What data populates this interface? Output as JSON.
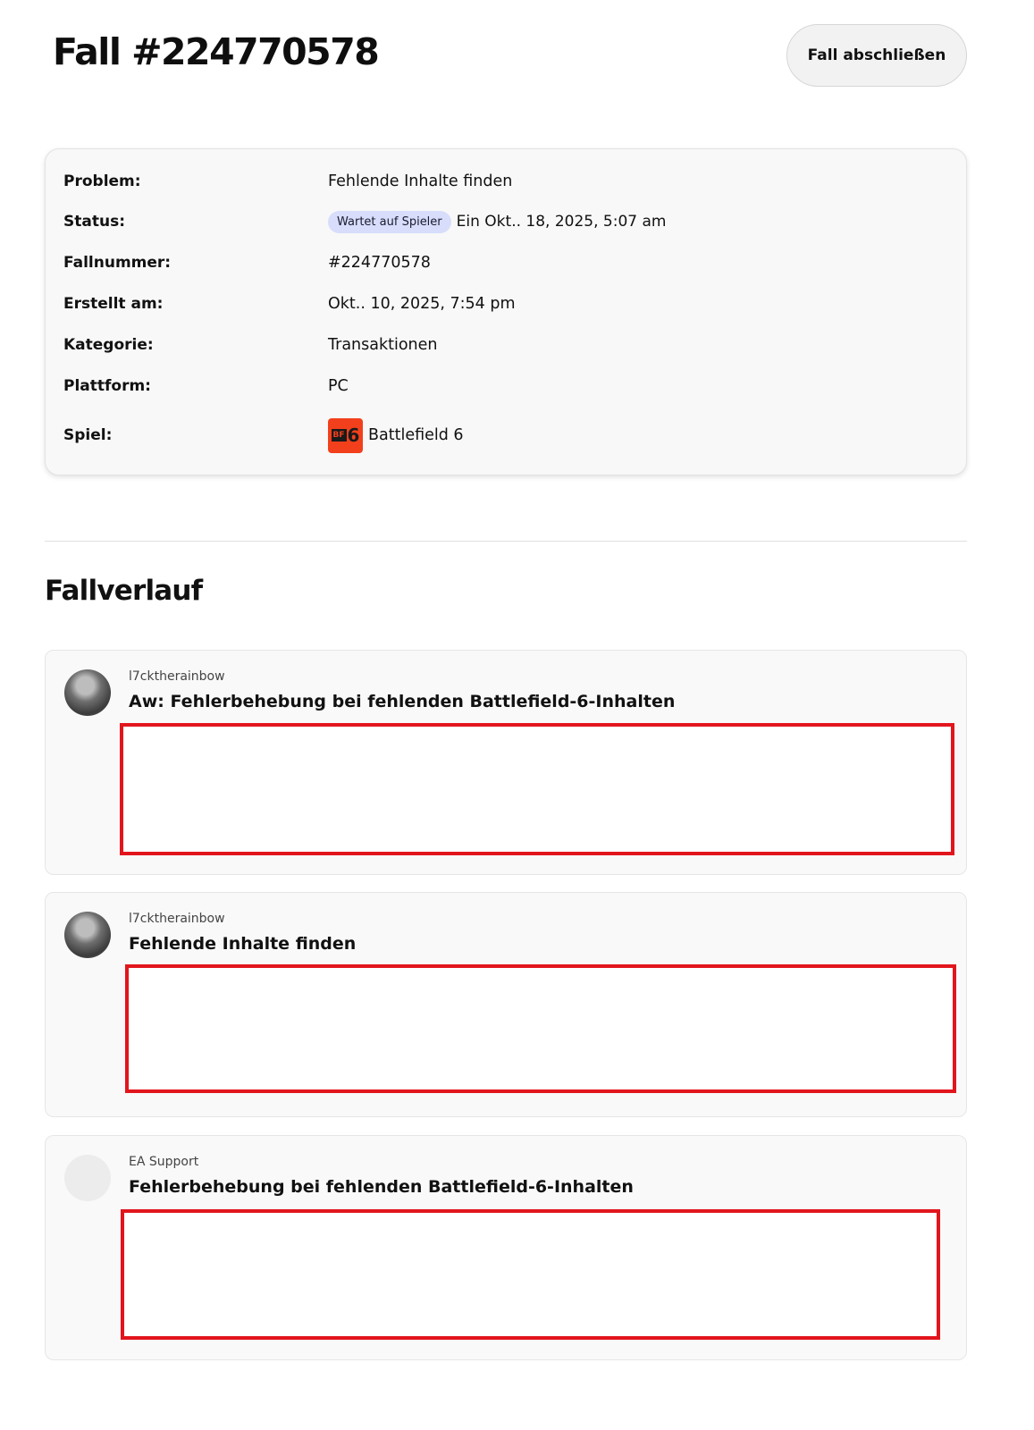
{
  "header": {
    "case_title": "Fall #224770578",
    "close_case_label": "Fall abschließen"
  },
  "details": {
    "problem": {
      "label": "Problem:",
      "value": "Fehlende Inhalte finden"
    },
    "status": {
      "label": "Status:",
      "badge": "Wartet auf Spieler",
      "date": "Ein Okt.. 18, 2025, 5:07 am"
    },
    "case_number": {
      "label": "Fallnummer:",
      "value": "#224770578"
    },
    "created": {
      "label": "Erstellt am:",
      "value": "Okt.. 10, 2025, 7:54 pm"
    },
    "category": {
      "label": "Kategorie:",
      "value": "Transaktionen"
    },
    "platform": {
      "label": "Plattform:",
      "value": "PC"
    },
    "game": {
      "label": "Spiel:",
      "value": "Battlefield 6",
      "logo_text_a": "BF",
      "logo_text_b": "6"
    }
  },
  "history": {
    "title": "Fallverlauf",
    "messages": [
      {
        "author": "l7cktherainbow",
        "subject": "Aw: Fehlerbehebung bei fehlenden Battlefield-6-Inhalten",
        "avatar": "user-photo"
      },
      {
        "author": "l7cktherainbow",
        "subject": "Fehlende Inhalte finden",
        "avatar": "user-photo"
      },
      {
        "author": "EA Support",
        "subject": "Fehlerbehebung bei fehlenden Battlefield-6-Inhalten",
        "avatar": "blank"
      }
    ]
  },
  "colors": {
    "status_badge_bg": "#d7ddfb",
    "redaction_border": "#e2151d",
    "game_logo_bg": "#f2401c"
  }
}
